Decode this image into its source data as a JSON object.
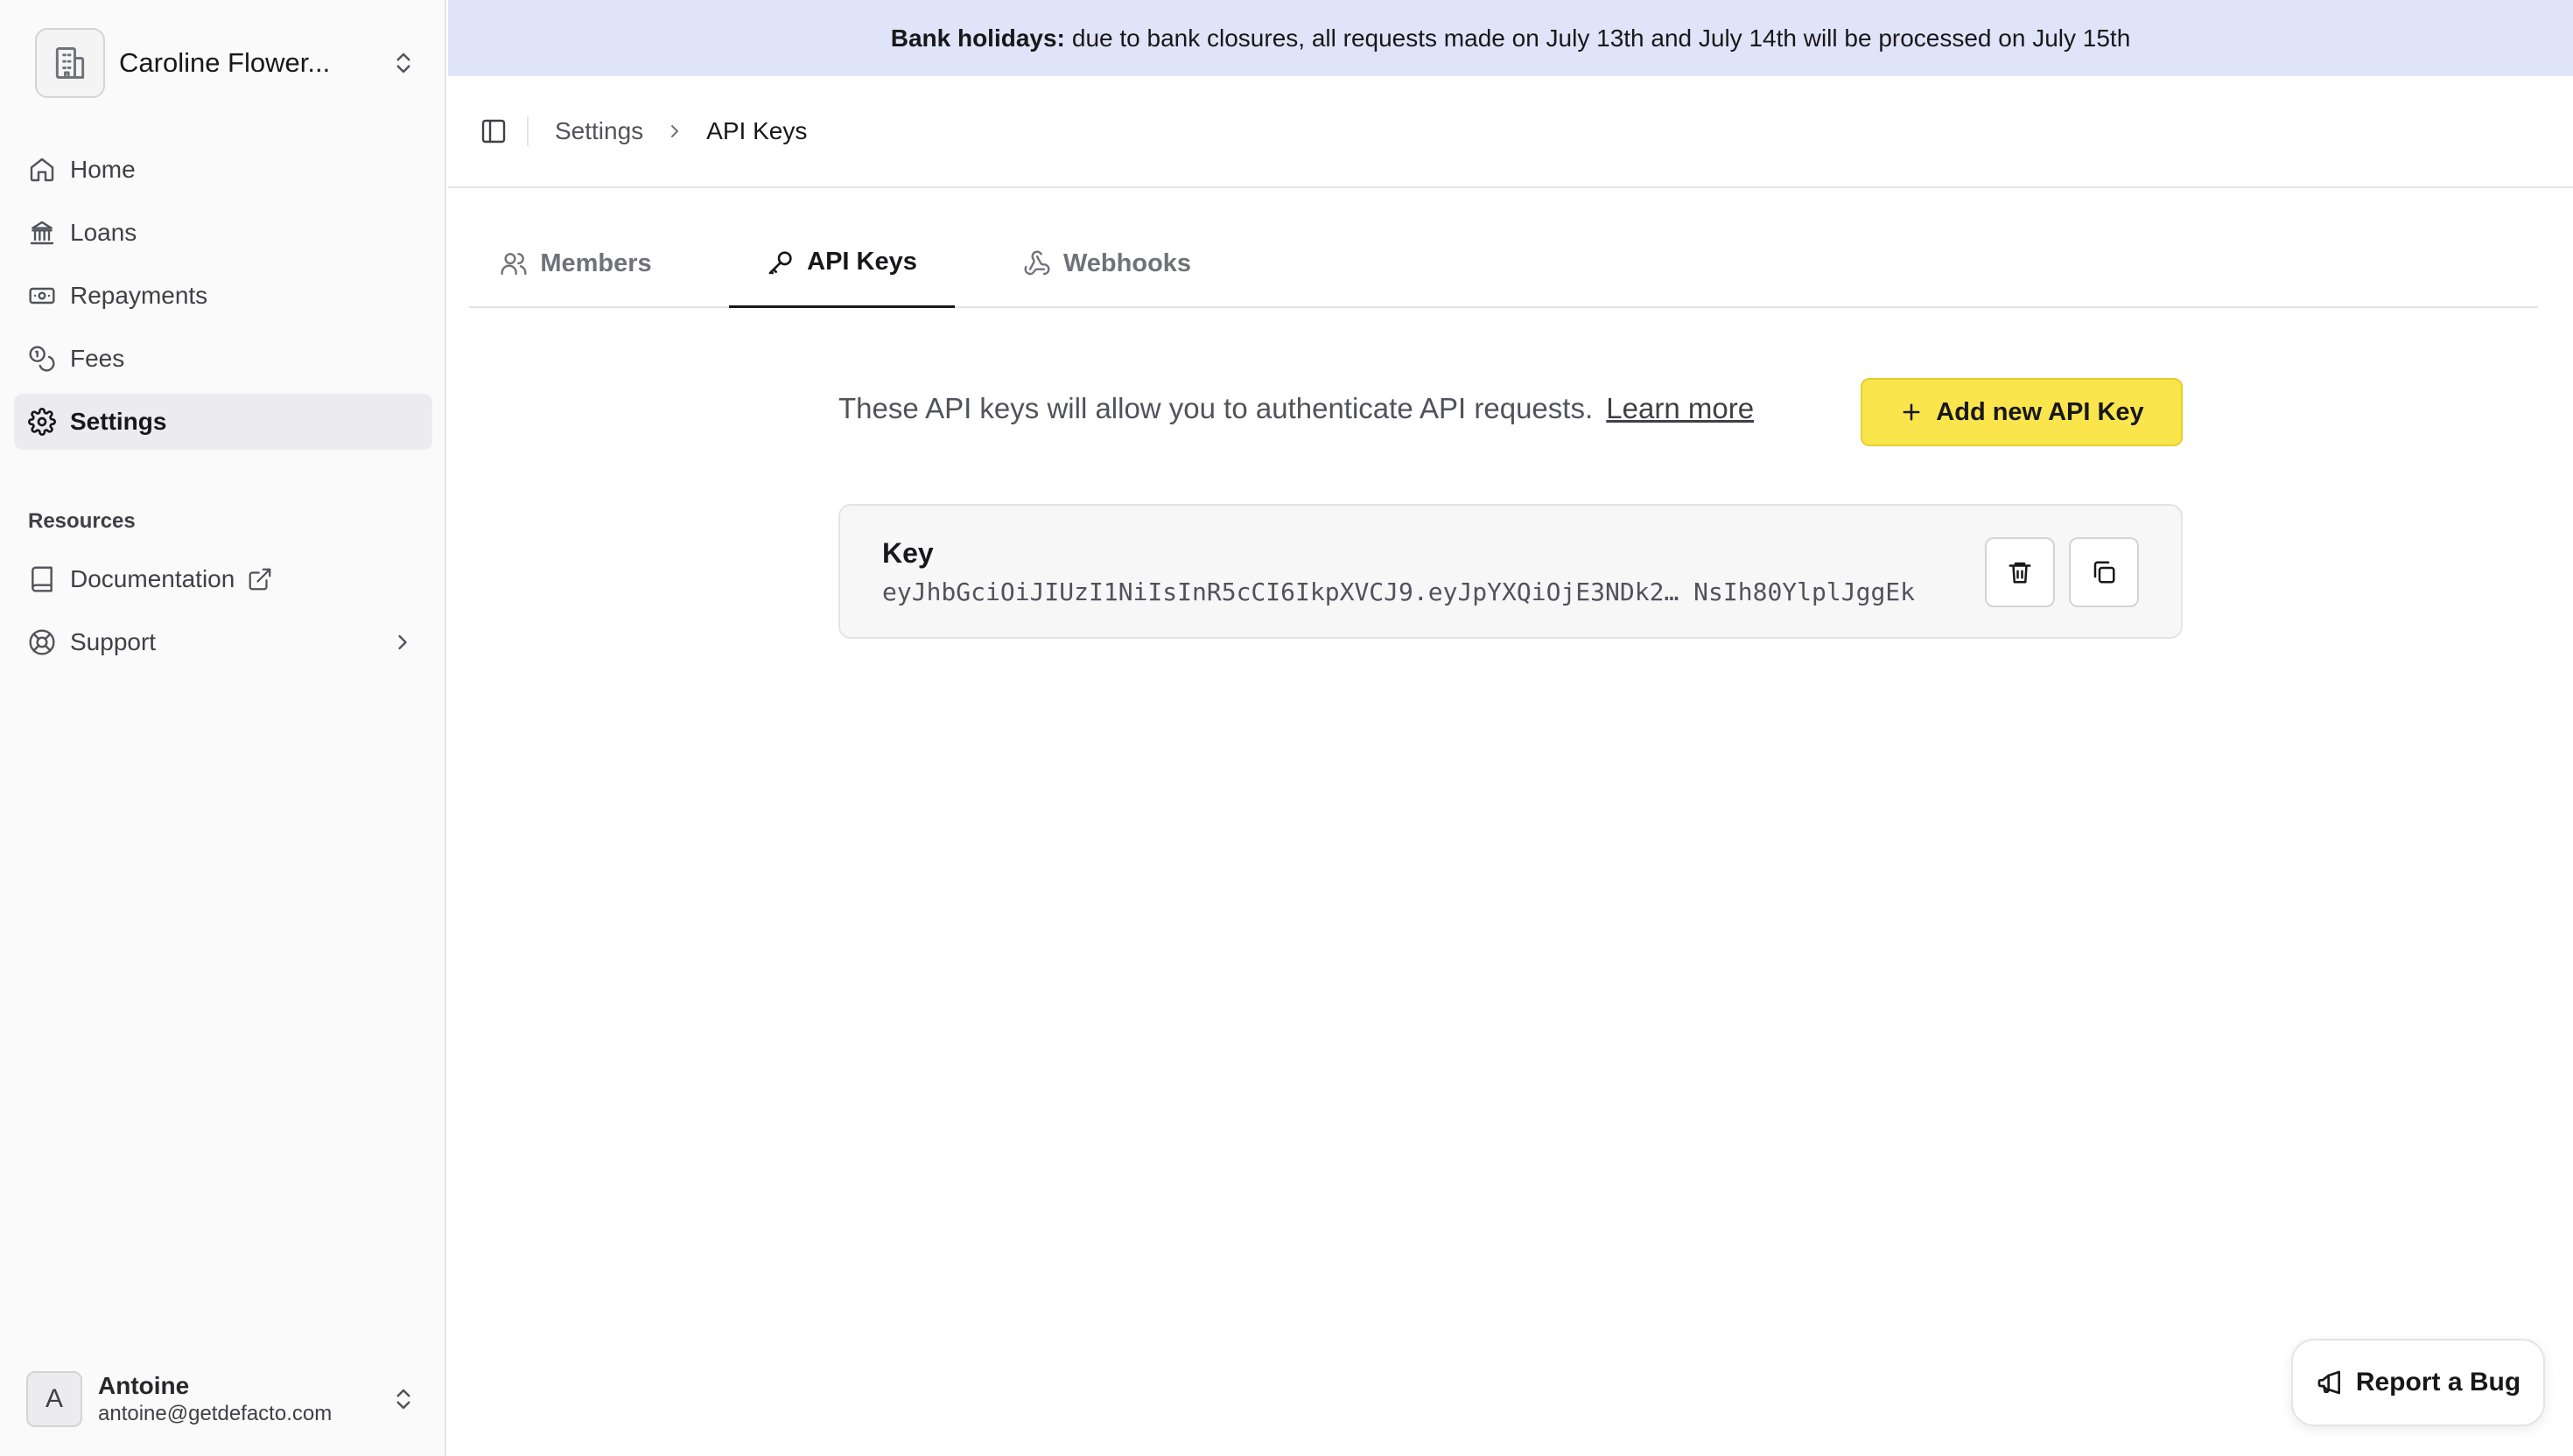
{
  "org": {
    "name": "Caroline Flower...",
    "icon": "building-icon"
  },
  "nav": {
    "items": [
      {
        "label": "Home",
        "icon": "home-icon"
      },
      {
        "label": "Loans",
        "icon": "bank-icon"
      },
      {
        "label": "Repayments",
        "icon": "banknote-icon"
      },
      {
        "label": "Fees",
        "icon": "coins-icon"
      },
      {
        "label": "Settings",
        "icon": "gear-icon",
        "active": true
      }
    ],
    "resources_heading": "Resources",
    "resources": [
      {
        "label": "Documentation",
        "icon": "book-icon"
      },
      {
        "label": "Support",
        "icon": "lifebuoy-icon"
      }
    ]
  },
  "user": {
    "name": "Antoine",
    "email": "antoine@getdefacto.com",
    "initial": "A"
  },
  "banner": {
    "title": "Bank holidays:",
    "text": "due to bank closures, all requests made on July 13th and July 14th will be processed on July 15th"
  },
  "breadcrumb": {
    "parent": "Settings",
    "current": "API Keys"
  },
  "tabs": [
    {
      "label": "Members",
      "icon": "users-icon"
    },
    {
      "label": "API Keys",
      "icon": "key-icon",
      "active": true
    },
    {
      "label": "Webhooks",
      "icon": "webhook-icon"
    }
  ],
  "intro": {
    "text": "These API keys will allow you to authenticate API requests.",
    "link": "Learn more"
  },
  "add_button": {
    "label": "Add new API Key"
  },
  "key_card": {
    "label": "Key",
    "value": "eyJhbGciOiJIUzI1NiIsInR5cCI6IkpXVCJ9.eyJpYXQiOjE3NDk2… NsIh80YlplJggEk"
  },
  "report_button": {
    "label": "Report a Bug"
  },
  "colors": {
    "accent": "#fbe54d",
    "banner_bg": "#e0e4f8",
    "active_nav_bg": "#ececee"
  }
}
